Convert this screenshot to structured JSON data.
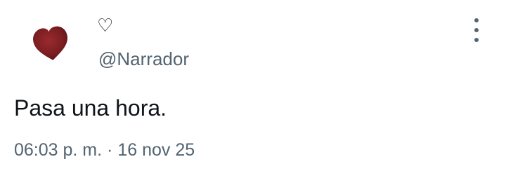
{
  "tweet": {
    "display_name": "♡",
    "handle": "@Narrador",
    "text": "Pasa una hora.",
    "time": "06:03 p. m.",
    "separator": "·",
    "date": "16 nov 25"
  },
  "icons": {
    "avatar": "dark-red-heart-avatar",
    "more": "more-vertical-icon"
  },
  "colors": {
    "avatar_heart": "#7a1e22",
    "secondary_text": "#536471",
    "primary_text": "#0f1419"
  }
}
